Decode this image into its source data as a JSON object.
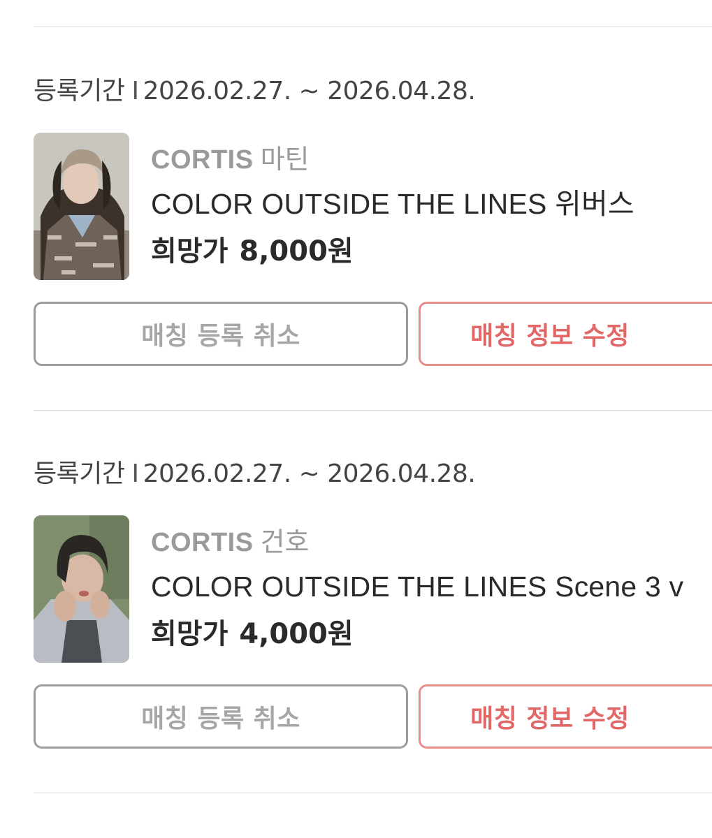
{
  "listings": [
    {
      "period_label": "등록기간",
      "period_separator": "I",
      "period_range": "2026.02.27. ~ 2026.04.28.",
      "artist_group": "CORTIS",
      "artist_member": "마틴",
      "title": "COLOR OUTSIDE THE LINES 위버스",
      "price_label": "희망가",
      "price_value": "8,000원",
      "cancel_label": "매칭 등록 취소",
      "edit_label": "매칭 정보 수정"
    },
    {
      "period_label": "등록기간",
      "period_separator": "I",
      "period_range": "2026.02.27. ~ 2026.04.28.",
      "artist_group": "CORTIS",
      "artist_member": "건호",
      "title": "COLOR OUTSIDE THE LINES Scene 3 v",
      "price_label": "희망가",
      "price_value": "4,000원",
      "cancel_label": "매칭 등록 취소",
      "edit_label": "매칭 정보 수정"
    }
  ],
  "colors": {
    "divider": "#dcdcdc",
    "cancel_border": "#9c9c9c",
    "cancel_text": "#a6a6a6",
    "edit_border": "#e98b8b",
    "edit_text": "#e26767",
    "artist_text": "#9a9a9a",
    "title_text": "#2a2a2a"
  }
}
